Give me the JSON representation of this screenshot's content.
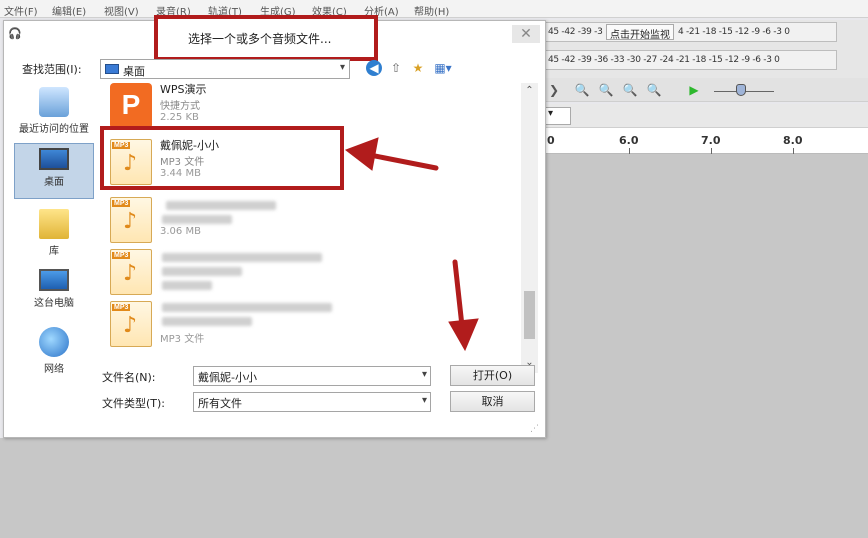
{
  "menubar": {
    "items": [
      "文件(F)",
      "编辑(E)",
      "视图(V)",
      "录音(R)",
      "轨道(T)",
      "生成(G)",
      "效果(C)",
      "分析(A)",
      "帮助(H)"
    ]
  },
  "meter": {
    "row1_scale": "45 -42 -39 -3",
    "monitor_label": "点击开始监视",
    "row1_scale_right": "4 -21 -18 -15 -12 -9 -6 -3 0",
    "row2_scale": "45 -42 -39 -36 -33 -30 -27 -24 -21 -18 -15 -12 -9 -6 -3 0"
  },
  "ruler": {
    "ticks": [
      "0",
      "6.0",
      "7.0",
      "8.0"
    ]
  },
  "dialog": {
    "title": "选择一个或多个音频文件...",
    "close_glyph": "✕",
    "lookin_label": "查找范围(I):",
    "lookin_value": "桌面",
    "places": [
      {
        "label": "最近访问的位置",
        "icon": "recent-places-icon"
      },
      {
        "label": "桌面",
        "icon": "desktop-icon"
      },
      {
        "label": "库",
        "icon": "library-icon"
      },
      {
        "label": "这台电脑",
        "icon": "computer-icon"
      },
      {
        "label": "网络",
        "icon": "network-icon"
      }
    ],
    "files": [
      {
        "name": "WPS演示",
        "type": "快捷方式",
        "size": "2.25 KB",
        "icon": "wps-presentation-icon"
      },
      {
        "name": "戴佩妮-小小",
        "type": "MP3 文件",
        "size": "3.44 MB",
        "icon": "mp3-file-icon"
      },
      {
        "name": "",
        "type": "",
        "size": "3.06 MB",
        "icon": "mp3-file-icon"
      },
      {
        "name": "",
        "type": "",
        "size": "",
        "icon": "mp3-file-icon"
      },
      {
        "name": "",
        "type": "",
        "size": "MP3 文件",
        "icon": "mp3-file-icon"
      }
    ],
    "filename_label": "文件名(N):",
    "filename_value": "戴佩妮-小小",
    "filetype_label": "文件类型(T):",
    "filetype_value": "所有文件",
    "open_button": "打开(O)",
    "cancel_button": "取消"
  },
  "colors": {
    "annotation_red": "#b11c1c",
    "wps_orange": "#f26b22",
    "mp3_orange": "#e08a1b"
  }
}
